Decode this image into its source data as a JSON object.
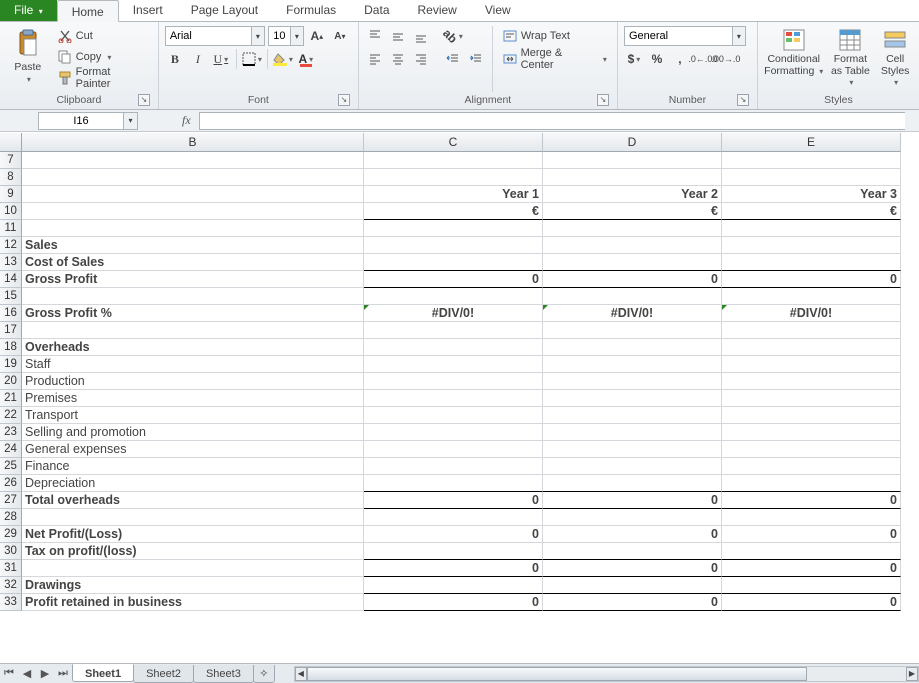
{
  "tabs": {
    "file": "File",
    "home": "Home",
    "insert": "Insert",
    "pageLayout": "Page Layout",
    "formulas": "Formulas",
    "data": "Data",
    "review": "Review",
    "view": "View"
  },
  "clipboard": {
    "paste": "Paste",
    "cut": "Cut",
    "copy": "Copy",
    "formatPainter": "Format Painter",
    "title": "Clipboard"
  },
  "font": {
    "name": "Arial",
    "size": "10",
    "title": "Font"
  },
  "alignment": {
    "wrap": "Wrap Text",
    "merge": "Merge & Center",
    "title": "Alignment"
  },
  "number": {
    "format": "General",
    "title": "Number"
  },
  "styles": {
    "cf": "Conditional Formatting",
    "fat": "Format as Table",
    "cs": "Cell Styles",
    "title": "Styles"
  },
  "namebox": "I16",
  "fx": "fx",
  "colHeaders": [
    "B",
    "C",
    "D",
    "E"
  ],
  "rows": [
    {
      "n": 7
    },
    {
      "n": 8
    },
    {
      "n": 9,
      "b": "",
      "c": "Year 1",
      "d": "Year 2",
      "e": "Year 3",
      "bold": true,
      "right": true
    },
    {
      "n": 10,
      "b": "",
      "c": "€",
      "d": "€",
      "e": "€",
      "bold": true,
      "right": true,
      "bb": true
    },
    {
      "n": 11,
      "b": ""
    },
    {
      "n": 12,
      "b": "Sales",
      "bold": true
    },
    {
      "n": 13,
      "b": "Cost of Sales",
      "bold": true,
      "bb": true
    },
    {
      "n": 14,
      "b": "Gross Profit",
      "bold": true,
      "c": "0",
      "d": "0",
      "e": "0",
      "right": true,
      "bb": true
    },
    {
      "n": 15
    },
    {
      "n": 16,
      "b": "Gross Profit %",
      "bold": true,
      "c": "#DIV/0!",
      "d": "#DIV/0!",
      "e": "#DIV/0!",
      "center": true,
      "tick": true
    },
    {
      "n": 17
    },
    {
      "n": 18,
      "b": "Overheads",
      "bold": true
    },
    {
      "n": 19,
      "b": "Staff"
    },
    {
      "n": 20,
      "b": "Production"
    },
    {
      "n": 21,
      "b": "Premises"
    },
    {
      "n": 22,
      "b": "Transport"
    },
    {
      "n": 23,
      "b": "Selling and promotion"
    },
    {
      "n": 24,
      "b": "General expenses"
    },
    {
      "n": 25,
      "b": "Finance"
    },
    {
      "n": 26,
      "b": "Depreciation",
      "bb": true
    },
    {
      "n": 27,
      "b": "Total overheads",
      "bold": true,
      "c": "0",
      "d": "0",
      "e": "0",
      "right": true,
      "bb": true
    },
    {
      "n": 28
    },
    {
      "n": 29,
      "b": "Net Profit/(Loss)",
      "bold": true,
      "c": "0",
      "d": "0",
      "e": "0",
      "right": true
    },
    {
      "n": 30,
      "b": "Tax on profit/(loss)",
      "bold": true,
      "bb": true
    },
    {
      "n": 31,
      "b": "",
      "c": "0",
      "d": "0",
      "e": "0",
      "right": true,
      "bold": true,
      "bb": true
    },
    {
      "n": 32,
      "b": "Drawings",
      "bold": true,
      "bb": true
    },
    {
      "n": 33,
      "b": "Profit retained in business",
      "bold": true,
      "c": "0",
      "d": "0",
      "e": "0",
      "right": true,
      "bb": true
    }
  ],
  "sheets": {
    "s1": "Sheet1",
    "s2": "Sheet2",
    "s3": "Sheet3"
  }
}
